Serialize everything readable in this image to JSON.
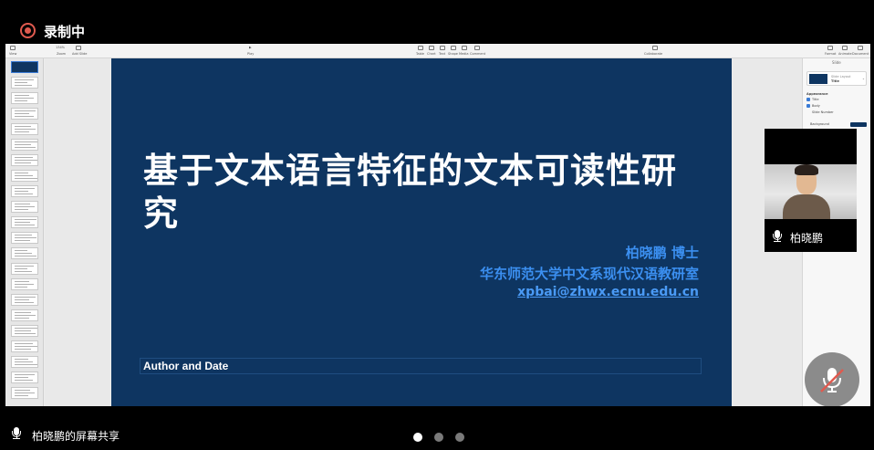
{
  "recording": {
    "label": "录制中",
    "color": "#e05a4f"
  },
  "keynote": {
    "toolbar": {
      "left": [
        "View",
        "Zoom",
        "Add Slide"
      ],
      "zoom_value": "134%",
      "center": [
        "Play"
      ],
      "insert": [
        "Table",
        "Chart",
        "Text",
        "Shape",
        "Media",
        "Comment"
      ],
      "collaborate": "Collaborate",
      "right": [
        "Format",
        "Animate",
        "Document"
      ]
    },
    "slide": {
      "title": "基于文本语言特征的文本可读性研究",
      "author": "柏晓鹏 博士",
      "affiliation": "华东师范大学中文系现代汉语教研室",
      "email": "xpbai@zhwx.ecnu.edu.cn",
      "footer": "Author and Date",
      "background_color": "#0e3561",
      "accent_color": "#3b8ff0"
    },
    "inspector": {
      "tab": "Slide",
      "layout_label": "Slide Layout",
      "layout_name": "Title",
      "appearance_heading": "Appearance",
      "options": [
        "Title",
        "Body",
        "Slide Number"
      ],
      "background_label": "Background"
    }
  },
  "participant": {
    "name": "柏晓鹏"
  },
  "share_label": "柏晓鹏的屏幕共享",
  "pager": {
    "count": 3,
    "active_index": 0
  }
}
